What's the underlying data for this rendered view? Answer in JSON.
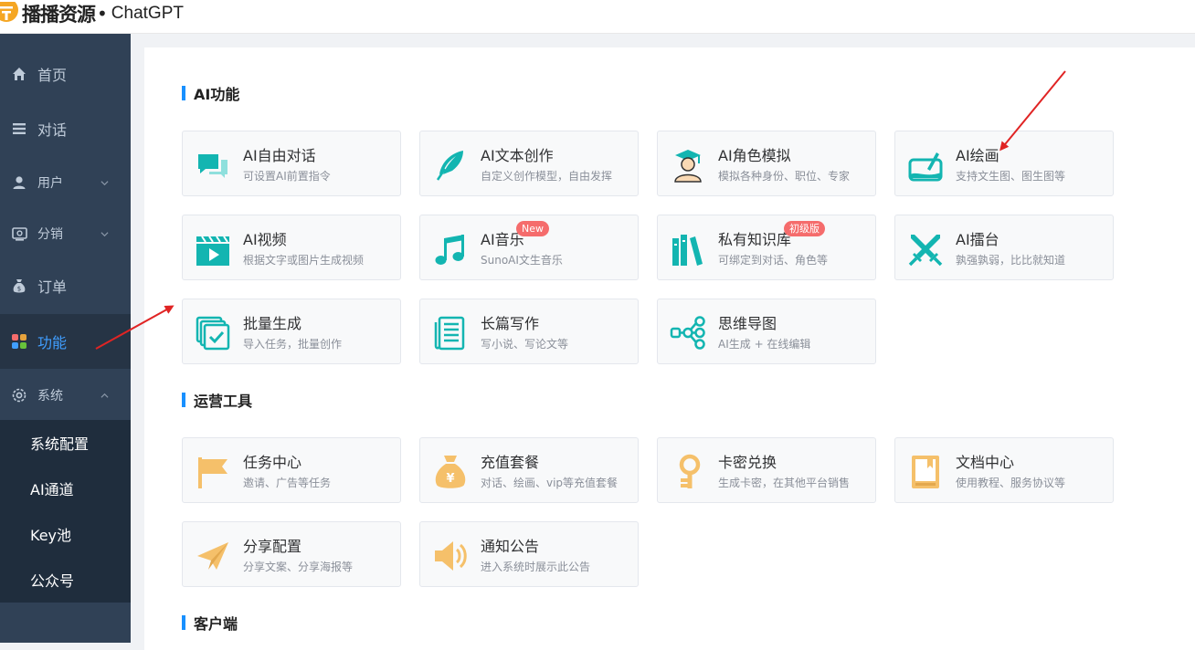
{
  "header": {
    "brand": "播播资源",
    "dot": "•",
    "product": "ChatGPT"
  },
  "sidebar": {
    "items": [
      {
        "label": "首页",
        "icon": "home-icon"
      },
      {
        "label": "对话",
        "icon": "list-icon"
      },
      {
        "label": "用户",
        "icon": "user-icon"
      },
      {
        "label": "分销",
        "icon": "distribution-icon"
      },
      {
        "label": "订单",
        "icon": "money-bag-icon"
      },
      {
        "label": "功能",
        "icon": "apps-icon",
        "active": true
      },
      {
        "label": "系统",
        "icon": "gear-icon",
        "expanded": true
      }
    ],
    "sub_items": [
      {
        "label": "系统配置"
      },
      {
        "label": "AI通道"
      },
      {
        "label": "Key池"
      },
      {
        "label": "公众号"
      }
    ]
  },
  "sections": [
    {
      "title": "AI功能",
      "cards": [
        {
          "title": "AI自由对话",
          "desc": "可设置AI前置指令",
          "icon": "chat-bubbles-icon"
        },
        {
          "title": "AI文本创作",
          "desc": "自定义创作模型，自由发挥",
          "icon": "feather-icon"
        },
        {
          "title": "AI角色模拟",
          "desc": "模拟各种身份、职位、专家",
          "icon": "graduate-icon"
        },
        {
          "title": "AI绘画",
          "desc": "支持文生图、图生图等",
          "icon": "painting-icon"
        },
        {
          "title": "AI视频",
          "desc": "根据文字或图片生成视频",
          "icon": "clapperboard-icon"
        },
        {
          "title": "AI音乐",
          "desc": "SunoAI文生音乐",
          "icon": "music-note-icon",
          "badge": "New"
        },
        {
          "title": "私有知识库",
          "desc": "可绑定到对话、角色等",
          "icon": "books-icon",
          "badge": "初级版"
        },
        {
          "title": "AI擂台",
          "desc": "孰强孰弱，比比就知道",
          "icon": "crossed-swords-icon"
        },
        {
          "title": "批量生成",
          "desc": "导入任务，批量创作",
          "icon": "batch-icon"
        },
        {
          "title": "长篇写作",
          "desc": "写小说、写论文等",
          "icon": "document-icon"
        },
        {
          "title": "思维导图",
          "desc": "AI生成 + 在线编辑",
          "icon": "mindmap-icon"
        }
      ]
    },
    {
      "title": "运营工具",
      "cards": [
        {
          "title": "任务中心",
          "desc": "邀请、广告等任务",
          "icon": "flag-icon"
        },
        {
          "title": "充值套餐",
          "desc": "对话、绘画、vip等充值套餐",
          "icon": "money-bag-yen-icon"
        },
        {
          "title": "卡密兑换",
          "desc": "生成卡密，在其他平台销售",
          "icon": "key-icon"
        },
        {
          "title": "文档中心",
          "desc": "使用教程、服务协议等",
          "icon": "book-icon"
        },
        {
          "title": "分享配置",
          "desc": "分享文案、分享海报等",
          "icon": "paper-plane-icon"
        },
        {
          "title": "通知公告",
          "desc": "进入系统时展示此公告",
          "icon": "speaker-icon"
        }
      ]
    },
    {
      "title": "客户端",
      "cards": []
    }
  ],
  "colors": {
    "sidebar_bg": "#304156",
    "sidebar_active_bg": "#263445",
    "submenu_bg": "#1f2d3d",
    "accent": "#409eff",
    "section_bar": "#1890ff",
    "teal_icon": "#13b5b1",
    "yellow_icon": "#f5c06a",
    "badge": "#f56c6c",
    "annotation_arrow": "#e02424"
  }
}
